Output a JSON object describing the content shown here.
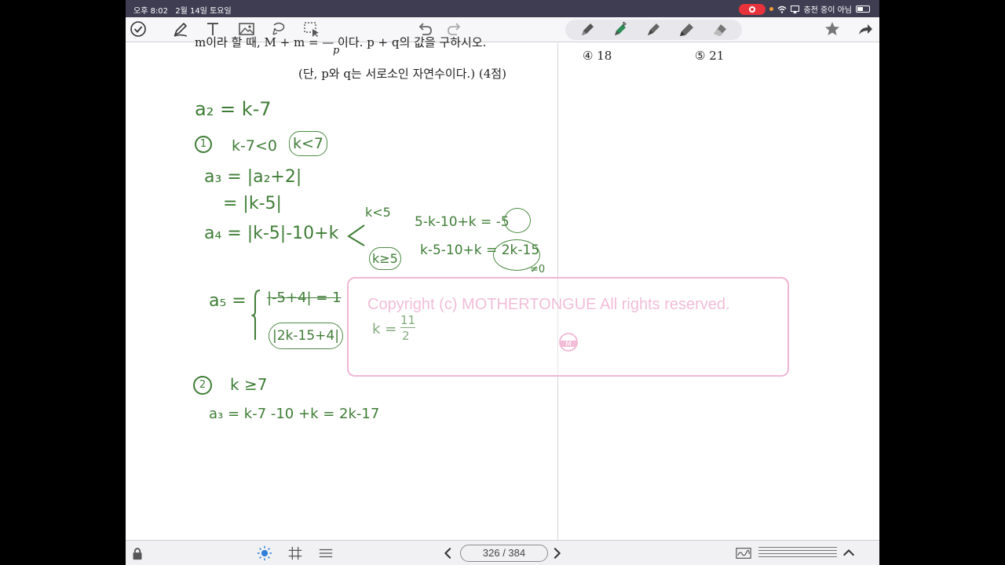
{
  "status": {
    "time": "오후 8:02",
    "date": "2월 14일 토요일",
    "charging": "충전 중이 아님"
  },
  "toolbar": {
    "tools": [
      "check-icon",
      "pen-tool-icon",
      "text-icon",
      "image-icon",
      "lasso-icon",
      "selection-icon"
    ],
    "undo": "undo-icon",
    "redo": "redo-icon",
    "pens": [
      "pencil-icon",
      "bluetooth-pen-icon",
      "fountain-pen-icon",
      "marker-icon",
      "eraser-icon"
    ],
    "accent": "#2e8b57"
  },
  "question": {
    "line1": "m이라 할 때, M + m = — 이다. p + q의 값을 구하시오.",
    "line1_denominator": "p",
    "line2": "(단, p와 q는 서로소인 자연수이다.) (4점)"
  },
  "choices": [
    {
      "label": "④ 18"
    },
    {
      "label": "⑤ 21"
    }
  ],
  "handwriting": [
    "a₂ = k-7",
    "①",
    "k-7<0",
    "k<7",
    "a₃ = |a₂+2|",
    "= |k-5|",
    "a₄ = |k-5|-10+k",
    "k<5",
    "k≥5",
    "5-k-10+k = -5",
    "k-5-10+k = 2k-15",
    "≠0",
    "a₅ =",
    "|-5+4| = 1",
    "|2k-15+4|",
    "k =",
    "11",
    "2",
    "②",
    "k ≥7",
    "a₃ = k-7 -10 +k = 2k-17"
  ],
  "watermark": {
    "text": "Copyright (c) MOTHERTONGUE All rights reserved.",
    "logo_letter": "M",
    "logo_caption": "MOTHERTONGUE"
  },
  "bottombar": {
    "page_indicator": "326 / 384",
    "icons": [
      "lock-icon",
      "brightness-icon",
      "grid-icon",
      "lines-icon",
      "prev-page-icon",
      "next-page-icon",
      "signature-icon",
      "collapse-icon"
    ]
  }
}
